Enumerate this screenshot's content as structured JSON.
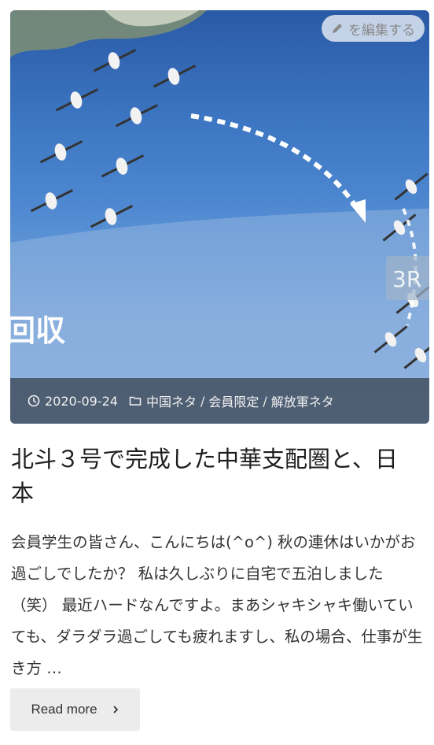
{
  "thumbnail": {
    "overlay_text": "回収",
    "side_text": "3R"
  },
  "edit_button": {
    "label": "を編集する",
    "icon": "pencil-icon"
  },
  "meta": {
    "date": "2020-09-24",
    "date_icon": "clock-icon",
    "category_icon": "folder-icon",
    "categories": [
      "中国ネタ",
      "会員限定",
      "解放軍ネタ"
    ],
    "separator": "/"
  },
  "post": {
    "title": "北斗３号で完成した中華支配圏と、日本",
    "excerpt": "会員学生の皆さん、こんにちは(^o^) 秋の連休はいかがお過ごしでしたか？ 私は久しぶりに自宅で五泊しました（笑） 最近ハードなんですよ。まあシャキシャキ働いていても、ダラダラ過ごしても疲れますし、私の場合、仕事が生き方 …"
  },
  "read_more": {
    "label": "Read more",
    "icon": "chevron-right-icon"
  },
  "colors": {
    "meta_bar": "#191919",
    "button_bg": "#ececec",
    "title": "#1e1e1e"
  }
}
